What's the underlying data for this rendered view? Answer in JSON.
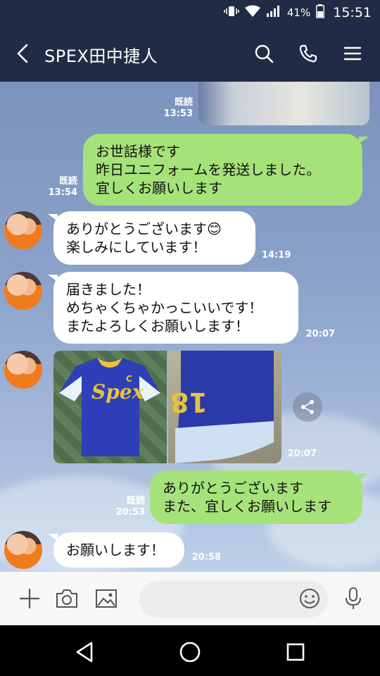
{
  "status_bar": {
    "battery_percent": "41%",
    "time": "15:51"
  },
  "header": {
    "title": "SPEX田中捷人"
  },
  "messages": {
    "m0": {
      "read": "既読",
      "time": "13:53"
    },
    "m1": {
      "read": "既読",
      "time": "13:54",
      "lines": [
        "お世話様です",
        "昨日ユニフォームを発送しました。",
        "宜しくお願いします"
      ]
    },
    "m2": {
      "time": "14:19",
      "lines": [
        "ありがとうございます😊",
        "楽しみにしています！"
      ]
    },
    "m3": {
      "time": "20:07",
      "lines": [
        "届きました！",
        "めちゃくちゃかっこいいです！",
        "またよろしくお願いします！"
      ]
    },
    "m4": {
      "time": "20:07",
      "jersey1_text": "Spex",
      "jersey1_letter": "C",
      "jersey2_number": "18"
    },
    "m5": {
      "read": "既読",
      "time": "20:53",
      "lines": [
        "ありがとうございます",
        "また、宜しくお願いします"
      ]
    },
    "m6": {
      "time": "20:58",
      "lines": [
        "お願いします！"
      ]
    }
  },
  "input": {
    "placeholder": ""
  },
  "colors": {
    "header": "#222b45",
    "outgoing_bubble": "#a6e27a",
    "incoming_bubble": "#ffffff"
  }
}
